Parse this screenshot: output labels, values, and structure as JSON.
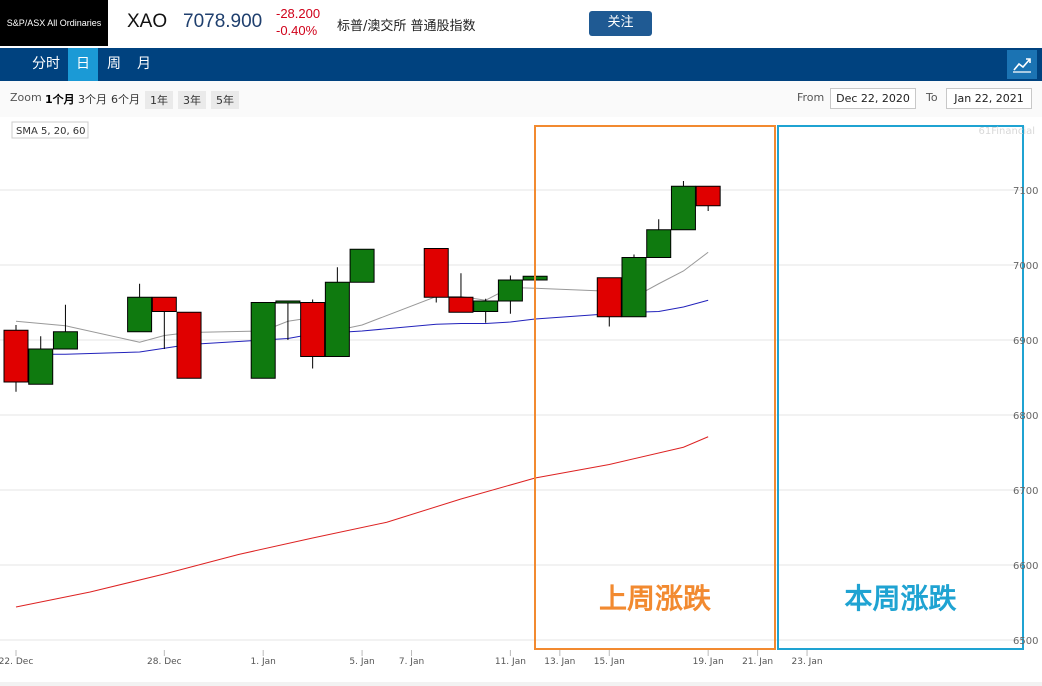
{
  "header": {
    "logo_text": "S&P/ASX All Ordinaries",
    "symbol": "XAO",
    "price": "7078.900",
    "change": "-28.200",
    "change_pct": "-0.40%",
    "index_name": "标普/澳交所 普通股指数",
    "follow_label": "关注"
  },
  "nav": {
    "tabs": [
      "分时",
      "日",
      "周",
      "月"
    ],
    "active_tab": "日",
    "chart_icon": "line-chart-icon"
  },
  "toolbar": {
    "zoom_label": "Zoom",
    "zoom_options": [
      "1个月",
      "3个月",
      "6个月",
      "1年",
      "3年",
      "5年"
    ],
    "zoom_selected": "1个月",
    "from_label": "From",
    "from_value": "Dec 22, 2020",
    "to_label": "To",
    "to_value": "Jan 22, 2021"
  },
  "chart_data": {
    "type": "candlestick",
    "indicator_label": "SMA 5, 20, 60",
    "watermark": "61Financial",
    "ylim": [
      6500,
      7150
    ],
    "y_ticks": [
      6500,
      6600,
      6700,
      6800,
      6900,
      7000,
      7100
    ],
    "y_tick_labels": [
      "6500",
      "6600",
      "6700",
      "6800",
      "6900",
      "7000",
      "7100"
    ],
    "x_ticks": [
      {
        "day": 0,
        "label": "22. Dec"
      },
      {
        "day": 6,
        "label": "28. Dec"
      },
      {
        "day": 10,
        "label": "1. Jan"
      },
      {
        "day": 14,
        "label": "5. Jan"
      },
      {
        "day": 16,
        "label": "7. Jan"
      },
      {
        "day": 20,
        "label": "11. Jan"
      },
      {
        "day": 22,
        "label": "13. Jan"
      },
      {
        "day": 24,
        "label": "15. Jan"
      },
      {
        "day": 28,
        "label": "19. Jan"
      },
      {
        "day": 30,
        "label": "21. Jan"
      },
      {
        "day": 32,
        "label": "23. Jan"
      }
    ],
    "candles": [
      {
        "day": 0,
        "date": "2020-12-22",
        "open": 6913,
        "high": 6920,
        "low": 6831,
        "close": 6844
      },
      {
        "day": 1,
        "date": "2020-12-23",
        "open": 6841,
        "high": 6905,
        "low": 6841,
        "close": 6888
      },
      {
        "day": 2,
        "date": "2020-12-24",
        "open": 6888,
        "high": 6947,
        "low": 6888,
        "close": 6911
      },
      {
        "day": 5,
        "date": "2020-12-29",
        "open": 6911,
        "high": 6975,
        "low": 6911,
        "close": 6957
      },
      {
        "day": 6,
        "date": "2020-12-30",
        "open": 6957,
        "high": 6957,
        "low": 6888,
        "close": 6938
      },
      {
        "day": 7,
        "date": "2020-12-31",
        "open": 6937,
        "high": 6937,
        "low": 6849,
        "close": 6849
      },
      {
        "day": 10,
        "date": "2021-01-04",
        "open": 6849,
        "high": 6950,
        "low": 6849,
        "close": 6950
      },
      {
        "day": 11,
        "date": "2021-01-05",
        "open": 6950,
        "high": 6952,
        "low": 6900,
        "close": 6952
      },
      {
        "day": 12,
        "date": "2021-01-06",
        "open": 6950,
        "high": 6954,
        "low": 6862,
        "close": 6878
      },
      {
        "day": 13,
        "date": "2021-01-07",
        "open": 6878,
        "high": 6997,
        "low": 6878,
        "close": 6977
      },
      {
        "day": 14,
        "date": "2021-01-08",
        "open": 6977,
        "high": 7021,
        "low": 6977,
        "close": 7021
      },
      {
        "day": 17,
        "date": "2021-01-11",
        "open": 7022,
        "high": 7022,
        "low": 6950,
        "close": 6957
      },
      {
        "day": 18,
        "date": "2021-01-12",
        "open": 6957,
        "high": 6989,
        "low": 6937,
        "close": 6937
      },
      {
        "day": 19,
        "date": "2021-01-13",
        "open": 6938,
        "high": 6955,
        "low": 6923,
        "close": 6952
      },
      {
        "day": 20,
        "date": "2021-01-14",
        "open": 6952,
        "high": 6986,
        "low": 6935,
        "close": 6980
      },
      {
        "day": 21,
        "date": "2021-01-15",
        "open": 6980,
        "high": 7016,
        "low": 6980,
        "close": 6985
      },
      {
        "day": 24,
        "date": "2021-01-18",
        "open": 6983,
        "high": 6983,
        "low": 6918,
        "close": 6931
      },
      {
        "day": 25,
        "date": "2021-01-19",
        "open": 6931,
        "high": 7014,
        "low": 6931,
        "close": 7010
      },
      {
        "day": 26,
        "date": "2021-01-20",
        "open": 7010,
        "high": 7061,
        "low": 7010,
        "close": 7047
      },
      {
        "day": 27,
        "date": "2021-01-21",
        "open": 7047,
        "high": 7112,
        "low": 7047,
        "close": 7105
      },
      {
        "day": 28,
        "date": "2021-01-22",
        "open": 7105,
        "high": 7105,
        "low": 7072,
        "close": 7079
      }
    ],
    "series": [
      {
        "name": "SMA 5",
        "color": "#999999",
        "days": [
          0,
          1,
          2,
          5,
          6,
          7,
          10,
          11,
          12,
          13,
          14,
          17,
          18,
          19,
          20,
          21,
          24,
          25,
          26,
          27,
          28
        ],
        "values": [
          6925,
          6922,
          6919,
          6897,
          6906,
          6910,
          6912,
          6925,
          6930,
          6913,
          6920,
          6958,
          6958,
          6953,
          6970,
          6969,
          6965,
          6957,
          6975,
          6992,
          7017
        ]
      },
      {
        "name": "SMA 20",
        "color": "#2222bb",
        "days": [
          0,
          1,
          2,
          5,
          6,
          7,
          10,
          11,
          12,
          13,
          14,
          17,
          18,
          19,
          20,
          21,
          24,
          25,
          26,
          27,
          28
        ],
        "values": [
          6880,
          6881,
          6881,
          6884,
          6889,
          6894,
          6900,
          6902,
          6908,
          6910,
          6912,
          6921,
          6922,
          6922,
          6924,
          6928,
          6935,
          6937,
          6938,
          6944,
          6953
        ]
      },
      {
        "name": "SMA 60",
        "color": "#dd2222",
        "days": [
          0,
          3,
          6,
          9,
          12,
          15,
          18,
          21,
          24,
          27,
          28
        ],
        "values": [
          6544,
          6564,
          6588,
          6614,
          6636,
          6657,
          6688,
          6716,
          6734,
          6757,
          6771
        ]
      }
    ],
    "annotations": [
      {
        "label": "上周涨跌",
        "color": "#f28a30",
        "from_day": 17,
        "to_day": 21
      },
      {
        "label": "本周涨跌",
        "color": "#1fa3d2",
        "from_day": 24,
        "to_day": 28
      }
    ],
    "up_color": "#0f7a0f",
    "down_color": "#e00000"
  }
}
